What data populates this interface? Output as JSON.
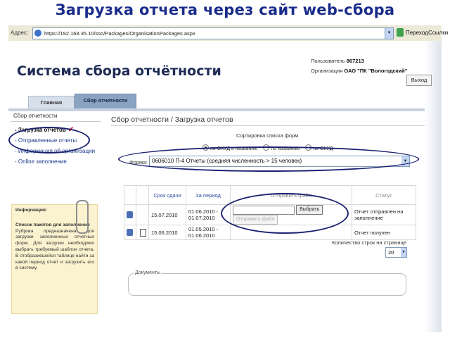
{
  "slide_title": "Загрузка отчета через сайт web-сбора",
  "browser": {
    "address_label": "Адрес:",
    "url": "https://192.168.35.10/sso/Packages/OrganisationPackages.aspx",
    "go_label": "Переход",
    "links_label": "Ссылки"
  },
  "header": {
    "system_title": "Система сбора отчётности",
    "user_label": "Пользователь",
    "user_value": "867213",
    "org_label": "Организация",
    "org_value": "ОАО \"ПК \"Вологодский\"",
    "logout_label": "Выход"
  },
  "tabs": [
    {
      "label": "Главная"
    },
    {
      "label": "Сбор отчетности"
    }
  ],
  "sidebar": {
    "heading": "Сбор отчетности",
    "items": [
      {
        "label": "- Загрузка отчетов"
      },
      {
        "label": "- Отправленные отчеты"
      },
      {
        "label": "- Информация об организации"
      },
      {
        "label": "- Online заполнение"
      }
    ]
  },
  "info_box": {
    "heading": "Информация:",
    "subheading": "Список пакетов для заполнения",
    "text": "Рубрика предназначена для загрузки заполненных отчетных форм. Для загрузки необходимо выбрать требуемый шаблон отчета. В отобразившейся таблице найти за какой период отчет и загрузить его в систему."
  },
  "main": {
    "heading": "Сбор отчетности / Загрузка отчетов",
    "sort_label": "Сортировка списка форм",
    "sort_options": [
      "по ОКУД и названию",
      "по названию",
      "по ОКУД"
    ],
    "sort_selected": "по ОКУД и названию",
    "form_label": "Форма:",
    "form_value": "0606010 П-4 Отчеты (средняя численность > 15 человек)",
    "table": {
      "headers": [
        "Срок сдачи",
        "За период",
        "Отправить файл",
        "Статус"
      ],
      "rows": [
        {
          "deadline": "15.07.2010",
          "period": "01.06.2010 - 01.07.2010",
          "status": "Отчет отправлен на заполнение"
        },
        {
          "deadline": "15.06.2010",
          "period": "01.05.2010 - 01.06.2010",
          "status": "Отчет получен"
        }
      ],
      "choose_label": "Выбрать",
      "send_label": "Отправить файл"
    },
    "rows_per_page_label": "Количество строк на странице",
    "rows_per_page_value": "20",
    "documents_label": "Документы"
  },
  "colors": {
    "title": "#1a2c8a",
    "annotation": "#1c2170",
    "checkmark": "#d21e1e"
  }
}
